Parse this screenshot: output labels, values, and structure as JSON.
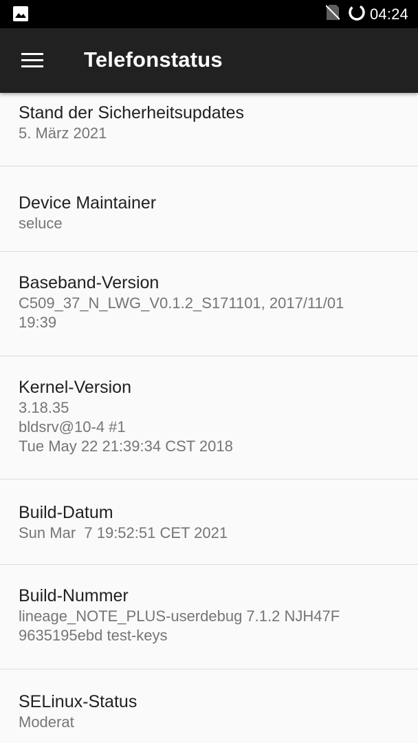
{
  "status_bar": {
    "time": "04:24",
    "icons": [
      "image-notification-icon",
      "no-sim-icon",
      "sync-loading-icon"
    ]
  },
  "toolbar": {
    "menu_icon": "hamburger-menu-icon",
    "title": "Telefonstatus"
  },
  "items": [
    {
      "title": "Stand der Sicherheitsupdates",
      "summary": "5. März 2021"
    },
    {
      "title": "Device Maintainer",
      "summary": "seluce"
    },
    {
      "title": "Baseband-Version",
      "summary": "C509_37_N_LWG_V0.1.2_S171101, 2017/11/01\n19:39"
    },
    {
      "title": "Kernel-Version",
      "summary": "3.18.35\nbldsrv@10-4 #1\nTue May 22 21:39:34 CST 2018"
    },
    {
      "title": "Build-Datum",
      "summary": "Sun Mar  7 19:52:51 CET 2021"
    },
    {
      "title": "Build-Nummer",
      "summary": "lineage_NOTE_PLUS-userdebug 7.1.2 NJH47F\n9635195ebd test-keys"
    },
    {
      "title": "SELinux-Status",
      "summary": "Moderat"
    }
  ],
  "colors": {
    "status_bar_bg": "#000000",
    "toolbar_bg": "#212121",
    "background": "#fafafa",
    "title_text": "#212121",
    "summary_text": "#757575",
    "divider": "#dcdcdc"
  }
}
